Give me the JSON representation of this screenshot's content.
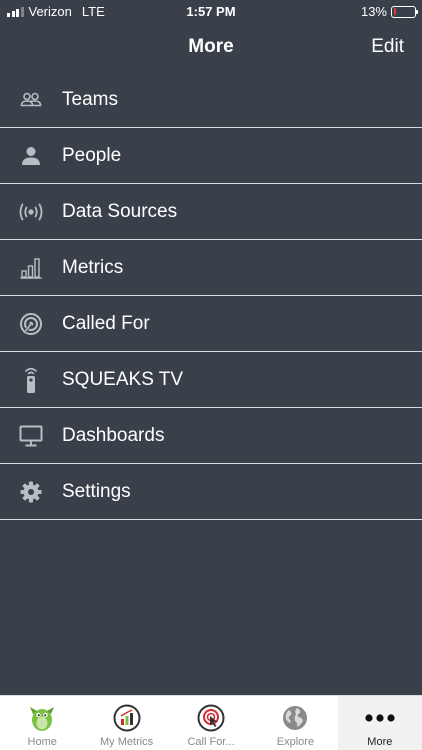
{
  "status_bar": {
    "carrier": "Verizon",
    "network": "LTE",
    "time": "1:57 PM",
    "battery": "13%",
    "battery_level": 0.13,
    "battery_color": "#e0383e"
  },
  "nav": {
    "title": "More",
    "edit_label": "Edit"
  },
  "menu": {
    "items": [
      {
        "label": "Teams",
        "icon": "teams-icon"
      },
      {
        "label": "People",
        "icon": "person-icon"
      },
      {
        "label": "Data Sources",
        "icon": "broadcast-icon"
      },
      {
        "label": "Metrics",
        "icon": "bar-chart-icon"
      },
      {
        "label": "Called For",
        "icon": "target-icon"
      },
      {
        "label": "SQUEAKS TV",
        "icon": "remote-icon"
      },
      {
        "label": "Dashboards",
        "icon": "monitor-icon"
      },
      {
        "label": "Settings",
        "icon": "gear-icon"
      }
    ]
  },
  "tabs": [
    {
      "label": "Home",
      "icon": "home-mascot-icon"
    },
    {
      "label": "My Metrics",
      "icon": "metrics-badge-icon"
    },
    {
      "label": "Call For...",
      "icon": "call-for-badge-icon"
    },
    {
      "label": "Explore",
      "icon": "globe-icon"
    },
    {
      "label": "More",
      "icon": "more-dots-icon",
      "active": true
    }
  ],
  "colors": {
    "background": "#394049",
    "divider": "#d9dcdf",
    "icon": "#b9bec4",
    "accent_green": "#7ac142",
    "accent_red": "#d8282f"
  }
}
